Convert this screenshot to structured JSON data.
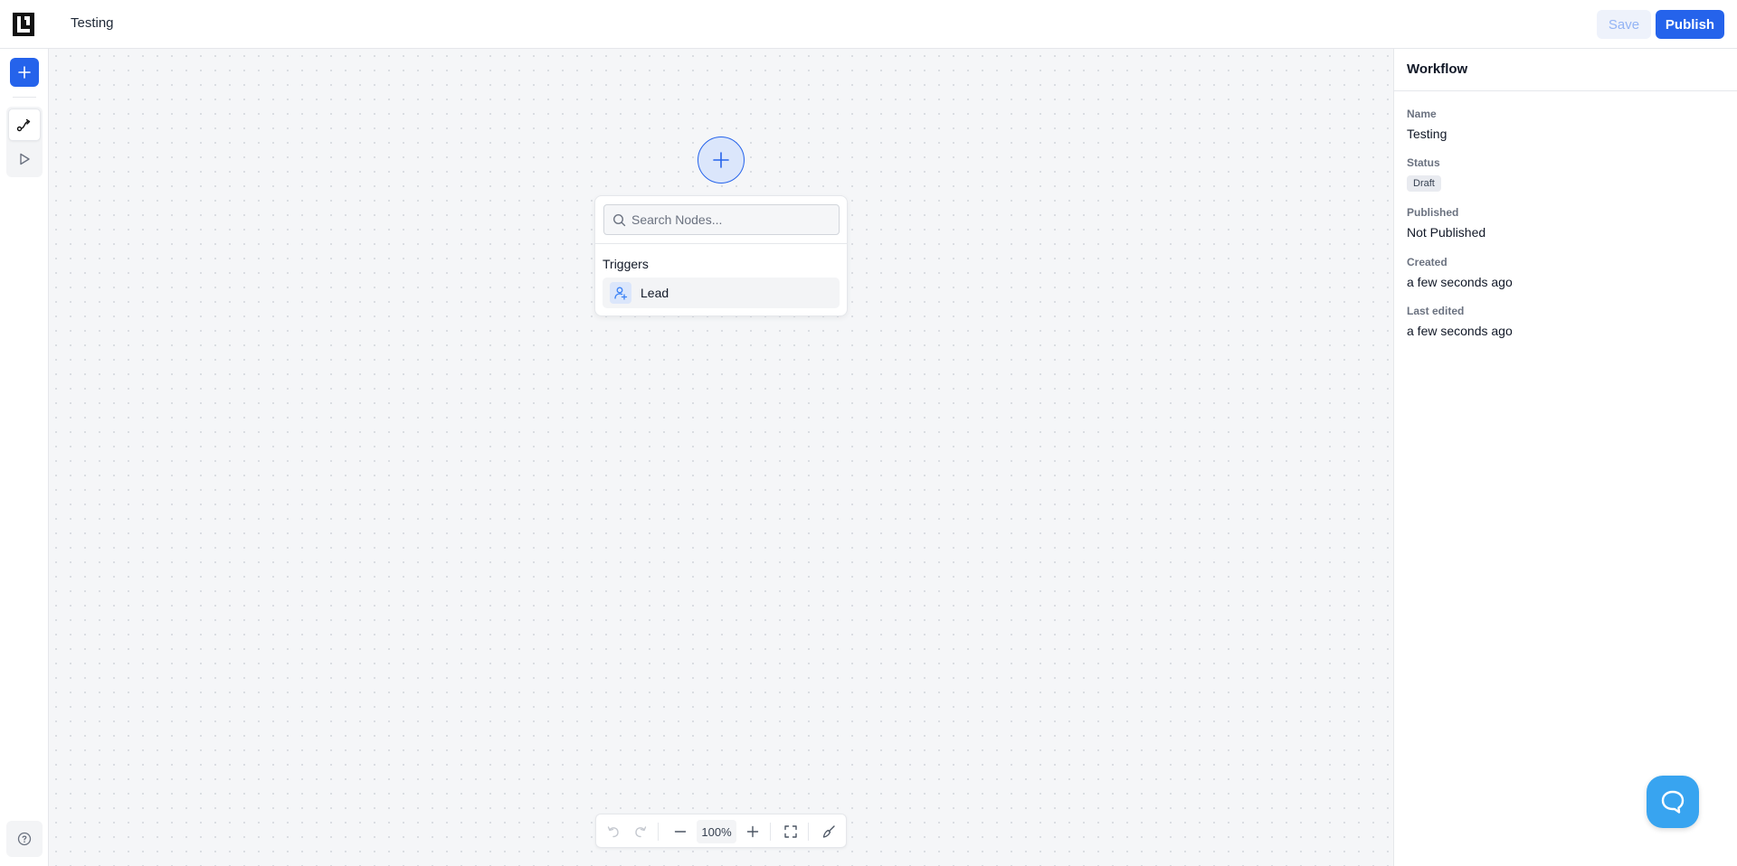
{
  "header": {
    "title": "Testing",
    "save_label": "Save",
    "publish_label": "Publish"
  },
  "sidebar": {
    "items": [
      {
        "icon": "plus-icon",
        "label": "add"
      },
      {
        "icon": "workflow-path-icon",
        "active": true
      },
      {
        "icon": "play-icon"
      },
      {
        "icon": "help-circle-icon"
      }
    ]
  },
  "canvas": {
    "add_node_icon": "plus-icon",
    "node_popup": {
      "search_placeholder": "Search Nodes...",
      "section_label": "Triggers",
      "items": [
        {
          "label": "Lead",
          "icon": "user-plus-icon"
        }
      ]
    },
    "controls": {
      "zoom_level": "100%",
      "icons": [
        "undo-icon",
        "redo-icon",
        "zoom-out-icon",
        "zoom-in-icon",
        "fit-view-icon",
        "clean-up-icon"
      ]
    }
  },
  "panel": {
    "title": "Workflow",
    "fields": [
      {
        "label": "Name",
        "value": "Testing"
      },
      {
        "label": "Status",
        "value": "Draft"
      },
      {
        "label": "Published",
        "value": "Not Published"
      },
      {
        "label": "Created",
        "value": "a few seconds ago"
      },
      {
        "label": "Last edited",
        "value": "a few seconds ago"
      }
    ]
  },
  "colors": {
    "accent": "#2563eb",
    "chat": "#38a4f0",
    "canvas_bg": "#f5f6f8"
  }
}
